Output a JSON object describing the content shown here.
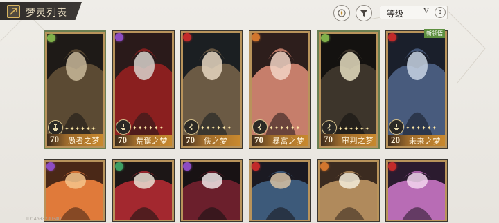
{
  "header": {
    "title": "梦灵列表",
    "title_icon": "back-arrow-icon",
    "filter_button_icon": "filter-icon",
    "settings_button_icon": "compass-icon",
    "sort": {
      "selected": "等级",
      "arrow": "V",
      "direction_icon": "sort-direction-icon"
    }
  },
  "colors": {
    "title_bg": "#2f2c2a",
    "title_text": "#f1e5c8",
    "card_frame": "#b8935b",
    "card_selected_border": "#6a7f52",
    "footer_gold": "#c9892e",
    "new_tag": "#5d8f3f"
  },
  "cards_row1": [
    {
      "level": "70",
      "name": "愚者之梦",
      "stars": "✦✦✦✦✦✦",
      "element_color": "#7fb04a",
      "class_icon": "knight-icon",
      "art_colors": [
        "#1e1a17",
        "#5b4a33",
        "#c9b99a"
      ]
    },
    {
      "level": "70",
      "name": "荒诞之梦",
      "stars": "✦✦✦✦✦✦",
      "element_color": "#8d4cc2",
      "class_icon": "knight-icon",
      "art_colors": [
        "#2a1a1a",
        "#8a1f1f",
        "#d8d2cc"
      ]
    },
    {
      "level": "70",
      "name": "佚之梦",
      "stars": "✦✦✦✦✦✦",
      "element_color": "#c22a2a",
      "class_icon": "runner-icon",
      "art_colors": [
        "#1b1f22",
        "#6b5a44",
        "#e6d7c1"
      ]
    },
    {
      "level": "70",
      "name": "暴富之梦",
      "stars": "✦✦✦✦✦✦",
      "element_color": "#d2762e",
      "class_icon": "runner-icon",
      "art_colors": [
        "#2d1e1c",
        "#c67e6b",
        "#f2d4c4"
      ]
    },
    {
      "level": "70",
      "name": "审判之梦",
      "stars": "✦✦✦✦✦✦",
      "element_color": "#7fb04a",
      "class_icon": "runner-icon",
      "art_colors": [
        "#141210",
        "#3d352b",
        "#e5ddc0"
      ]
    },
    {
      "level": "20",
      "name": "未来之梦",
      "stars": "✦✦✦✦✦✦",
      "element_color": "#c22a2a",
      "class_icon": "knight-icon",
      "art_colors": [
        "#1a1f2b",
        "#485b7d",
        "#c8d3e3"
      ],
      "tag": "新领悟"
    }
  ],
  "cards_row2": [
    {
      "element_color": "#8d4cc2",
      "art_colors": [
        "#4a2817",
        "#e07a3a",
        "#f4c48c"
      ]
    },
    {
      "element_color": "#3d9e63",
      "art_colors": [
        "#1c1616",
        "#a3282f",
        "#eadfd2"
      ]
    },
    {
      "element_color": "#8d4cc2",
      "art_colors": [
        "#181214",
        "#6b1f2c",
        "#f0e6e6"
      ]
    },
    {
      "element_color": "#c22a2a",
      "art_colors": [
        "#1b1a22",
        "#3d5a7a",
        "#d6c2a5"
      ]
    },
    {
      "element_color": "#d2762e",
      "art_colors": [
        "#3b2b20",
        "#b08a5c",
        "#f5ecd9"
      ]
    },
    {
      "element_color": "#c22a2a",
      "art_colors": [
        "#2b1b2f",
        "#b86cb5",
        "#f3d6ee"
      ]
    }
  ],
  "footer": {
    "uid": "ID: 4593230340"
  }
}
